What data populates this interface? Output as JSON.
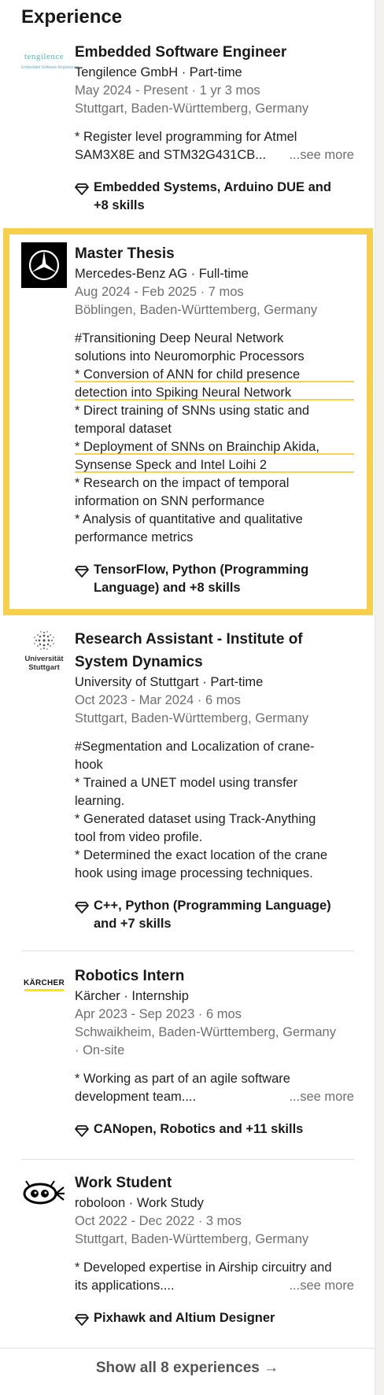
{
  "section": {
    "title": "Experience"
  },
  "entries": [
    {
      "logo_text": "tengilence",
      "logo_subtext": "Embedded Software Engineering",
      "title": "Embedded Software Engineer",
      "company": "Tengilence GmbH · Part-time",
      "dates": "May 2024 - Present · 1 yr 3 mos",
      "location": "Stuttgart, Baden-Württemberg, Germany",
      "desc": [
        "* Register level programming for Atmel",
        "SAM3X8E and STM32G431CB..."
      ],
      "see_more": "...see more",
      "skills": [
        "Embedded Systems, Arduino DUE and",
        "+8 skills"
      ]
    },
    {
      "title": "Master Thesis",
      "company": "Mercedes-Benz AG · Full-time",
      "dates": "Aug 2024 - Feb 2025 · 7 mos",
      "location": "Böblingen, Baden-Württemberg, Germany",
      "desc": [
        "#Transitioning Deep Neural Network",
        "solutions into Neuromorphic Processors",
        "* Conversion of ANN for child presence",
        "detection into Spiking Neural Network",
        "* Direct training of SNNs using static and",
        "temporal dataset",
        "* Deployment of SNNs on Brainchip Akida,",
        "Synsense Speck and Intel Loihi 2",
        "* Research on the impact of temporal",
        "information on SNN performance",
        "* Analysis of quantitative and qualitative",
        "performance metrics"
      ],
      "skills": [
        "TensorFlow, Python (Programming",
        "Language) and +8 skills"
      ]
    },
    {
      "logo_text": "Universität\nStuttgart",
      "title_lines": [
        "Research Assistant - Institute of",
        "System Dynamics"
      ],
      "company": "University of Stuttgart · Part-time",
      "dates": "Oct 2023 - Mar 2024 · 6 mos",
      "location": "Stuttgart, Baden-Württemberg, Germany",
      "desc": [
        "#Segmentation and Localization of crane-",
        "hook",
        " * Trained a UNET model using transfer",
        "learning.",
        " * Generated dataset using Track-Anything",
        "tool from video profile.",
        " * Determined the exact location of the crane",
        "hook using image processing techniques."
      ],
      "skills": [
        "C++, Python (Programming Language)",
        "and +7 skills"
      ]
    },
    {
      "logo_text": "KÄRCHER",
      "title": "Robotics Intern",
      "company": "Kärcher · Internship",
      "dates": "Apr 2023 - Sep 2023 · 6 mos",
      "location": "Schwaikheim, Baden-Württemberg, Germany",
      "location2": "· On-site",
      "desc": [
        "* Working as part of an agile software",
        "development team...."
      ],
      "see_more": "...see more",
      "skills": [
        "CANopen, Robotics and +11 skills"
      ]
    },
    {
      "title": "Work Student",
      "company": "roboloon · Work Study",
      "dates": "Oct 2022 - Dec 2022 · 3 mos",
      "location": "Stuttgart, Baden-Württemberg, Germany",
      "desc": [
        "* Developed expertise in Airship circuitry and",
        "its applications...."
      ],
      "see_more": "...see more",
      "skills": [
        "Pixhawk and Altium Designer"
      ]
    }
  ],
  "footer": {
    "show_all": "Show all 8 experiences →"
  },
  "colors": {
    "highlight": "#f6d04d",
    "muted": "#6f6f6f",
    "karcher_yellow": "#ffe600"
  }
}
